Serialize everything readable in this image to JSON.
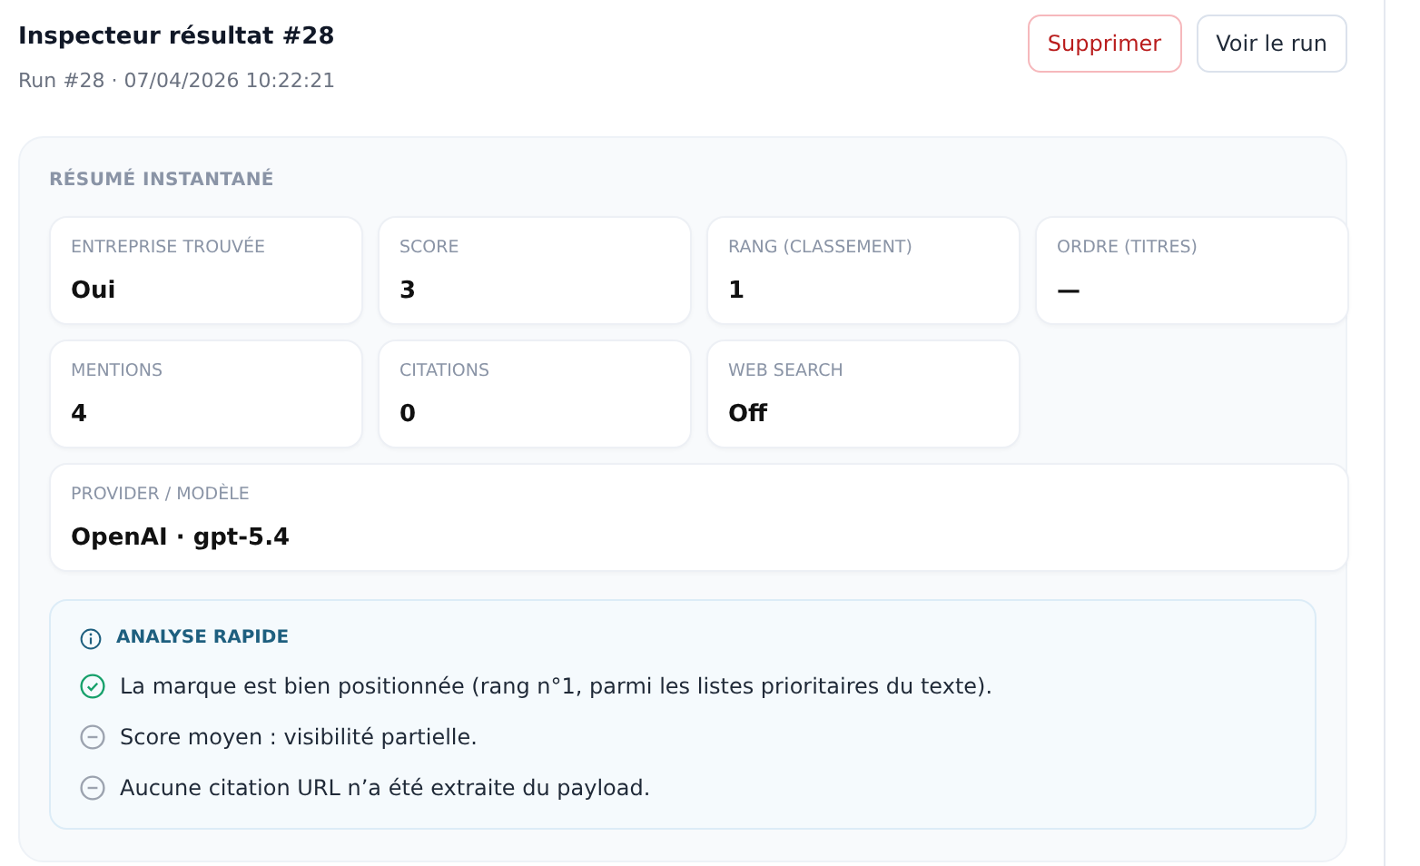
{
  "header": {
    "title": "Inspecteur résultat #28",
    "subtitle": "Run #28 · 07/04/2026 10:22:21"
  },
  "actions": [
    {
      "label": "Supprimer",
      "kind": "danger"
    },
    {
      "label": "Voir le run",
      "kind": "default"
    }
  ],
  "summary": {
    "heading": "RÉSUMÉ INSTANTANÉ",
    "stats": [
      {
        "label": "ENTREPRISE TROUVÉE",
        "value": "Oui"
      },
      {
        "label": "SCORE",
        "value": "3"
      },
      {
        "label": "RANG (CLASSEMENT)",
        "value": "1"
      },
      {
        "label": "ORDRE (TITRES)",
        "value": "—"
      },
      {
        "label": "MENTIONS",
        "value": "4"
      },
      {
        "label": "CITATIONS",
        "value": "0"
      },
      {
        "label": "WEB SEARCH",
        "value": "Off"
      },
      {
        "label": "PROVIDER / MODÈLE",
        "value": "OpenAI · gpt-5.4",
        "wide": true
      }
    ],
    "analysis": {
      "heading": "ANALYSE RAPIDE",
      "items": [
        {
          "kind": "positive",
          "text": "La marque est bien positionnée (rang n°1, parmi les listes prioritaires du texte)."
        },
        {
          "kind": "neutral",
          "text": "Score moyen : visibilité partielle."
        },
        {
          "kind": "neutral",
          "text": "Aucune citation URL n’a été extraite du payload."
        }
      ]
    }
  }
}
